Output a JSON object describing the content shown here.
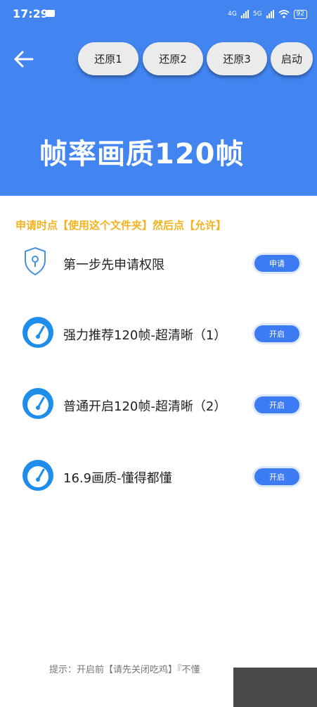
{
  "status_bar": {
    "time": "17:29",
    "network1": "4G",
    "network2": "5G",
    "battery": "92"
  },
  "toolbar": {
    "restore1": "还原1",
    "restore2": "还原2",
    "restore3": "还原3",
    "start": "启动"
  },
  "header": {
    "title": "帧率画质120帧"
  },
  "notice": "申请时点【使用这个文件夹】然后点【允许】",
  "rows": [
    {
      "label": "第一步先申请权限",
      "action": "申请",
      "icon": "shield-icon"
    },
    {
      "label": "强力推荐120帧-超清晰（1）",
      "action": "开启",
      "icon": "speedometer-icon"
    },
    {
      "label": "普通开启120帧-超清晰（2）",
      "action": "开启",
      "icon": "speedometer-icon"
    },
    {
      "label": "16.9画质-懂得都懂",
      "action": "开启",
      "icon": "speedometer-icon"
    }
  ],
  "footer": {
    "tip": "提示：开启前【请先关闭吃鸡】『不懂"
  },
  "colors": {
    "header_bg": "#4285F0",
    "accent_button": "#3D7BF3",
    "notice_text": "#F2B320"
  }
}
